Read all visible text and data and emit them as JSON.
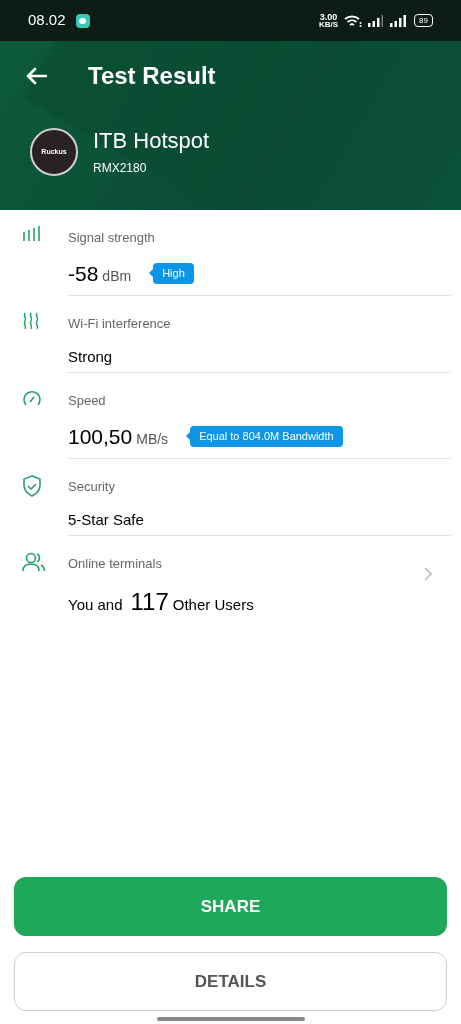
{
  "status_bar": {
    "time": "08.02",
    "net_speed": "3.00",
    "net_unit": "KB/S",
    "battery": "89"
  },
  "header": {
    "title": "Test Result",
    "network_name": "ITB Hotspot",
    "device": "RMX2180",
    "logo_text": "Ruckus"
  },
  "results": [
    {
      "kind": "metric",
      "label": "Signal strength",
      "value": "-58",
      "unit": "dBm",
      "badge": "High"
    },
    {
      "kind": "text",
      "label": "Wi-Fi interference",
      "value": "Strong"
    },
    {
      "kind": "metric",
      "label": "Speed",
      "value": "100,50",
      "unit": "MB/s",
      "badge": "Equal to 804.0M Bandwidth"
    },
    {
      "kind": "text",
      "label": "Security",
      "value": "5-Star Safe"
    },
    {
      "kind": "count",
      "label": "Online terminals",
      "prefix": "You and",
      "value": "117",
      "unit": "Other Users",
      "chevron": true
    }
  ],
  "buttons": [
    {
      "kind": "primary",
      "label": "SHARE"
    },
    {
      "kind": "secondary",
      "label": "DETAILS"
    }
  ]
}
